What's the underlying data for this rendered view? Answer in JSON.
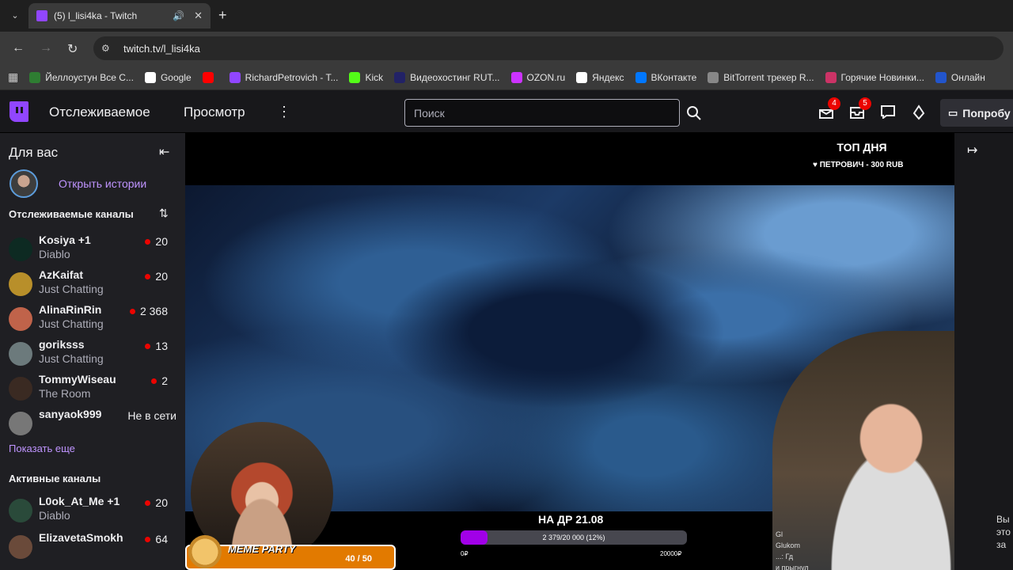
{
  "browser": {
    "tab_title": "(5) l_lisi4ka - Twitch",
    "url": "twitch.tv/l_lisi4ka",
    "bookmarks": [
      {
        "label": "Йеллоустун Все С...",
        "color": "#2e7d32",
        "icon": "video-icon"
      },
      {
        "label": "Google",
        "color": "#ffffff",
        "icon": "google-icon"
      },
      {
        "label": "",
        "color": "#ff0000",
        "icon": "youtube-icon"
      },
      {
        "label": "RichardPetrovich - T...",
        "color": "#9146ff",
        "icon": "twitch-icon"
      },
      {
        "label": "Kick",
        "color": "#53fc18",
        "icon": "kick-icon"
      },
      {
        "label": "Видеохостинг RUT...",
        "color": "#222266",
        "icon": "rutube-icon"
      },
      {
        "label": "OZON.ru",
        "color": "#cc33ff",
        "icon": "ozon-icon"
      },
      {
        "label": "Яндекс",
        "color": "#ffffff",
        "icon": "yandex-icon"
      },
      {
        "label": "ВКонтакте",
        "color": "#0077ff",
        "icon": "vk-icon"
      },
      {
        "label": "BitTorrent трекер R...",
        "color": "#888888",
        "icon": "torrent-icon"
      },
      {
        "label": "Горячие Новинки...",
        "color": "#cc3366",
        "icon": "news-icon"
      },
      {
        "label": "Онлайн",
        "color": "#2255cc",
        "icon": "online-icon"
      }
    ]
  },
  "twitch": {
    "nav_following": "Отслеживаемое",
    "nav_browse": "Просмотр",
    "search_placeholder": "Поиск",
    "notif_badge_1": "4",
    "notif_badge_2": "5",
    "prime_label": "Попробу",
    "accent": "#9146ff"
  },
  "sidebar": {
    "for_you": "Для вас",
    "open_stories": "Открыть истории",
    "followed_header": "Отслеживаемые каналы",
    "followed": [
      {
        "name": "Kosiya +1",
        "game": "Diablo",
        "viewers": "20",
        "avatar": "#0d2a22"
      },
      {
        "name": "AzKaifat",
        "game": "Just Chatting",
        "viewers": "20",
        "avatar": "#b88f2a"
      },
      {
        "name": "AlinaRinRin",
        "game": "Just Chatting",
        "viewers": "2 368",
        "avatar": "#c0634a"
      },
      {
        "name": "goriksss",
        "game": "Just Chatting",
        "viewers": "13",
        "avatar": "#6c7a7c"
      },
      {
        "name": "TommyWiseau",
        "game": "The Room",
        "viewers": "2",
        "avatar": "#3a2a22"
      }
    ],
    "offline_channel": {
      "name": "sanyaok999",
      "status": "Не в сети"
    },
    "show_more": "Показать еще",
    "active_header": "Активные каналы",
    "active": [
      {
        "name": "L0ok_At_Me +1",
        "game": "Diablo",
        "viewers": "20",
        "avatar": "#2a4a3a"
      },
      {
        "name": "ElizavetaSmokh",
        "game": "",
        "viewers": "64",
        "avatar": "#6a4a3a"
      }
    ]
  },
  "player": {
    "top_day_title": "ТОП ДНЯ",
    "top_day_donor": "♥ ПЕТРОВИЧ - 300 RUB",
    "goal_title": "НА ДР 21.08",
    "goal_progress_text": "2 379/20 000 (12%)",
    "goal_fraction": 0.12,
    "goal_min": "0₽",
    "goal_max": "20000₽",
    "meme_label": "MEME PARTY",
    "meme_count": "40 / 50",
    "chat_peek": [
      "Gl",
      "Glukom",
      "...: Гд",
      "и прыгнул"
    ]
  },
  "right_peek": [
    "Вы",
    "это",
    "за"
  ]
}
